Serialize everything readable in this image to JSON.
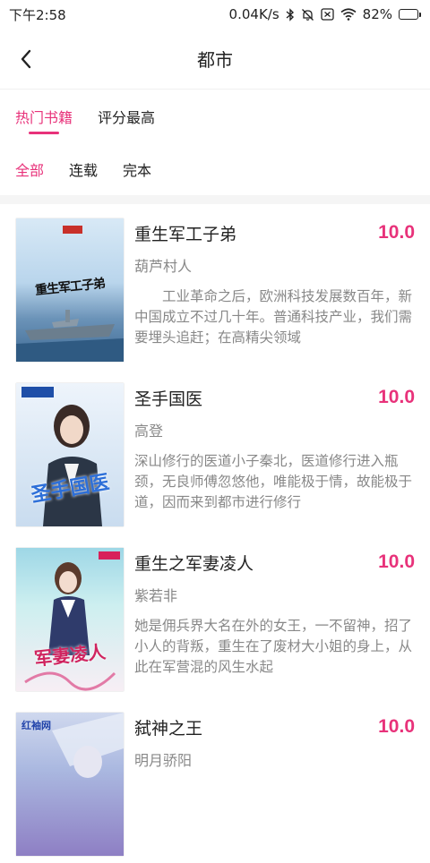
{
  "status": {
    "time": "下午2:58",
    "network_speed": "0.04K/s",
    "battery": "82%",
    "icons": [
      "bluetooth-icon",
      "mute-icon",
      "sim-icon",
      "wifi-icon",
      "battery-charging-icon"
    ]
  },
  "header": {
    "title": "都市",
    "back_icon": "chevron-left-icon"
  },
  "tabs": [
    {
      "label": "热门书籍",
      "active": true
    },
    {
      "label": "评分最高",
      "active": false
    }
  ],
  "filters": [
    {
      "label": "全部",
      "active": true
    },
    {
      "label": "连载",
      "active": false
    },
    {
      "label": "完本",
      "active": false
    }
  ],
  "books": [
    {
      "title": "重生军工子弟",
      "score": "10.0",
      "author": "葫芦村人",
      "desc": "　　工业革命之后，欧洲科技发展数百年，新中国成立不过几十年。普通科技产业，我们需要埋头追赶；在高精尖领域",
      "cover_text": "重生军工子弟"
    },
    {
      "title": "圣手国医",
      "score": "10.0",
      "author": "高登",
      "desc": "深山修行的医道小子秦北，医道修行进入瓶颈，无良师傅忽悠他，唯能极于情，故能极于道，因而来到都市进行修行",
      "cover_text": "圣手国医"
    },
    {
      "title": "重生之军妻凌人",
      "score": "10.0",
      "author": "紫若非",
      "desc": "她是佣兵界大名在外的女王，一不留神，招了小人的背叛，重生在了废材大小姐的身上，从此在军营混的风生水起",
      "cover_text": "军妻凌人"
    },
    {
      "title": "弑神之王",
      "score": "10.0",
      "author": "明月骄阳",
      "desc": "",
      "cover_text": "红袖网"
    }
  ]
}
